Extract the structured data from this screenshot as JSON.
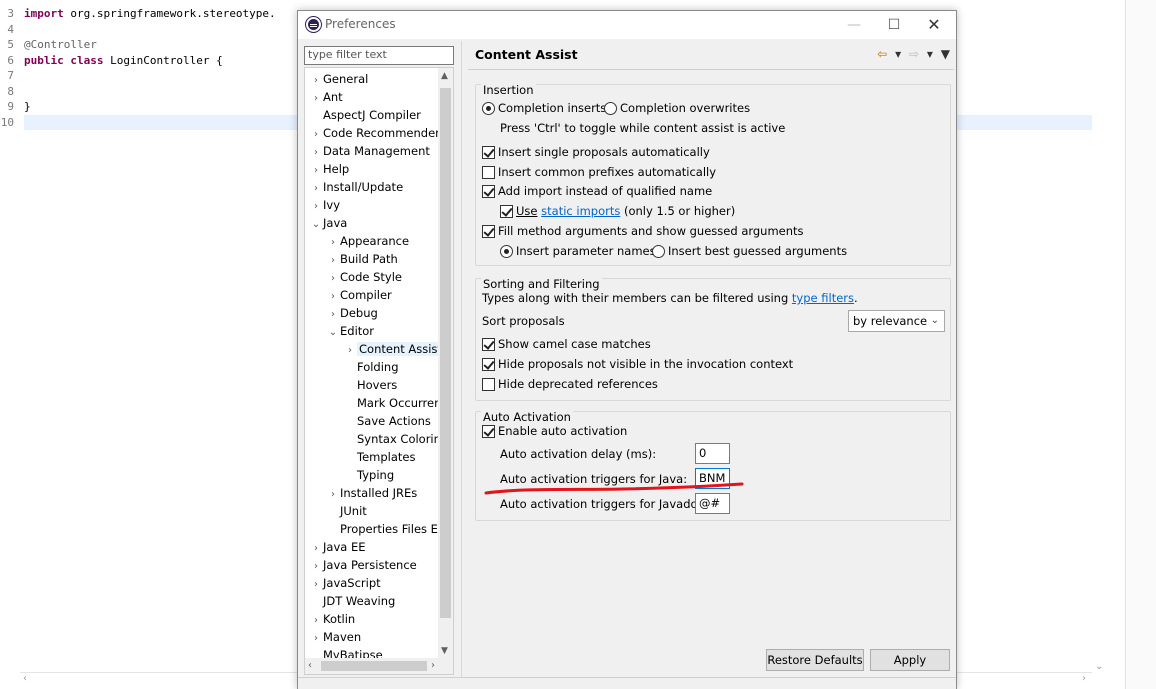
{
  "editor": {
    "lines": [
      {
        "num": "3",
        "segments": [
          {
            "t": "import",
            "c": "kw"
          },
          {
            "t": " org.springframework.stereotype.",
            "c": ""
          }
        ]
      },
      {
        "num": "4",
        "segments": []
      },
      {
        "num": "5",
        "segments": [
          {
            "t": "@Controller",
            "c": "ann"
          }
        ]
      },
      {
        "num": "6",
        "segments": [
          {
            "t": "public",
            "c": "kw"
          },
          {
            "t": " ",
            "c": ""
          },
          {
            "t": "class",
            "c": "kw"
          },
          {
            "t": " LoginController {",
            "c": ""
          }
        ]
      },
      {
        "num": "7",
        "segments": []
      },
      {
        "num": "8",
        "segments": []
      },
      {
        "num": "9",
        "segments": [
          {
            "t": "}",
            "c": ""
          }
        ]
      },
      {
        "num": "10",
        "segments": []
      }
    ]
  },
  "dialog": {
    "title": "Preferences",
    "filter_placeholder": "type filter text",
    "page_title": "Content Assist",
    "tree": [
      {
        "label": "General",
        "depth": 0,
        "arrow": "›"
      },
      {
        "label": "Ant",
        "depth": 0,
        "arrow": "›"
      },
      {
        "label": "AspectJ Compiler",
        "depth": 0,
        "arrow": ""
      },
      {
        "label": "Code Recommenders",
        "depth": 0,
        "arrow": "›"
      },
      {
        "label": "Data Management",
        "depth": 0,
        "arrow": "›"
      },
      {
        "label": "Help",
        "depth": 0,
        "arrow": "›"
      },
      {
        "label": "Install/Update",
        "depth": 0,
        "arrow": "›"
      },
      {
        "label": "Ivy",
        "depth": 0,
        "arrow": "›"
      },
      {
        "label": "Java",
        "depth": 0,
        "arrow": "⌄"
      },
      {
        "label": "Appearance",
        "depth": 1,
        "arrow": "›"
      },
      {
        "label": "Build Path",
        "depth": 1,
        "arrow": "›"
      },
      {
        "label": "Code Style",
        "depth": 1,
        "arrow": "›"
      },
      {
        "label": "Compiler",
        "depth": 1,
        "arrow": "›"
      },
      {
        "label": "Debug",
        "depth": 1,
        "arrow": "›"
      },
      {
        "label": "Editor",
        "depth": 1,
        "arrow": "⌄"
      },
      {
        "label": "Content Assist",
        "depth": 2,
        "arrow": "›",
        "selected": true
      },
      {
        "label": "Folding",
        "depth": 2,
        "arrow": ""
      },
      {
        "label": "Hovers",
        "depth": 2,
        "arrow": ""
      },
      {
        "label": "Mark Occurren",
        "depth": 2,
        "arrow": ""
      },
      {
        "label": "Save Actions",
        "depth": 2,
        "arrow": ""
      },
      {
        "label": "Syntax Coloring",
        "depth": 2,
        "arrow": ""
      },
      {
        "label": "Templates",
        "depth": 2,
        "arrow": ""
      },
      {
        "label": "Typing",
        "depth": 2,
        "arrow": ""
      },
      {
        "label": "Installed JREs",
        "depth": 1,
        "arrow": "›"
      },
      {
        "label": "JUnit",
        "depth": 1,
        "arrow": ""
      },
      {
        "label": "Properties Files Ed",
        "depth": 1,
        "arrow": ""
      },
      {
        "label": "Java EE",
        "depth": 0,
        "arrow": "›"
      },
      {
        "label": "Java Persistence",
        "depth": 0,
        "arrow": "›"
      },
      {
        "label": "JavaScript",
        "depth": 0,
        "arrow": "›"
      },
      {
        "label": "JDT Weaving",
        "depth": 0,
        "arrow": ""
      },
      {
        "label": "Kotlin",
        "depth": 0,
        "arrow": "›"
      },
      {
        "label": "Maven",
        "depth": 0,
        "arrow": "›"
      },
      {
        "label": "MyBatipse",
        "depth": 0,
        "arrow": ""
      }
    ],
    "insertion": {
      "title": "Insertion",
      "completion_inserts": "Completion inserts",
      "completion_overwrites": "Completion overwrites",
      "toggle_hint": "Press 'Ctrl' to toggle while content assist is active",
      "insert_single": "Insert single proposals automatically",
      "insert_common": "Insert common prefixes automatically",
      "add_import": "Add import instead of qualified name",
      "use_prefix": "Use",
      "static_imports": "static imports",
      "use_suffix": "(only 1.5 or higher)",
      "fill_method": "Fill method arguments and show guessed arguments",
      "insert_param_names": "Insert parameter names",
      "insert_best_guessed": "Insert best guessed arguments"
    },
    "sorting": {
      "title": "Sorting and Filtering",
      "types_prefix": "Types along with their members can be filtered using",
      "type_filters": "type filters",
      "types_suffix": ".",
      "sort_label": "Sort proposals",
      "sort_value": "by relevance",
      "camel_case": "Show camel case matches",
      "hide_not_visible": "Hide proposals not visible in the invocation context",
      "hide_deprecated": "Hide deprecated references"
    },
    "auto": {
      "title": "Auto Activation",
      "enable": "Enable auto activation",
      "delay_label": "Auto activation delay (ms):",
      "delay_value": "0",
      "java_label": "Auto activation triggers for Java:",
      "java_value": "BNM",
      "javadoc_label": "Auto activation triggers for Javadoc:",
      "javadoc_value": "@#"
    },
    "buttons": {
      "restore": "Restore Defaults",
      "apply": "Apply"
    }
  },
  "colors": {
    "annotation_mark": "#e3141b",
    "link": "#0066cc",
    "keyword": "#7f0055",
    "selection": "#e5f3ff"
  }
}
